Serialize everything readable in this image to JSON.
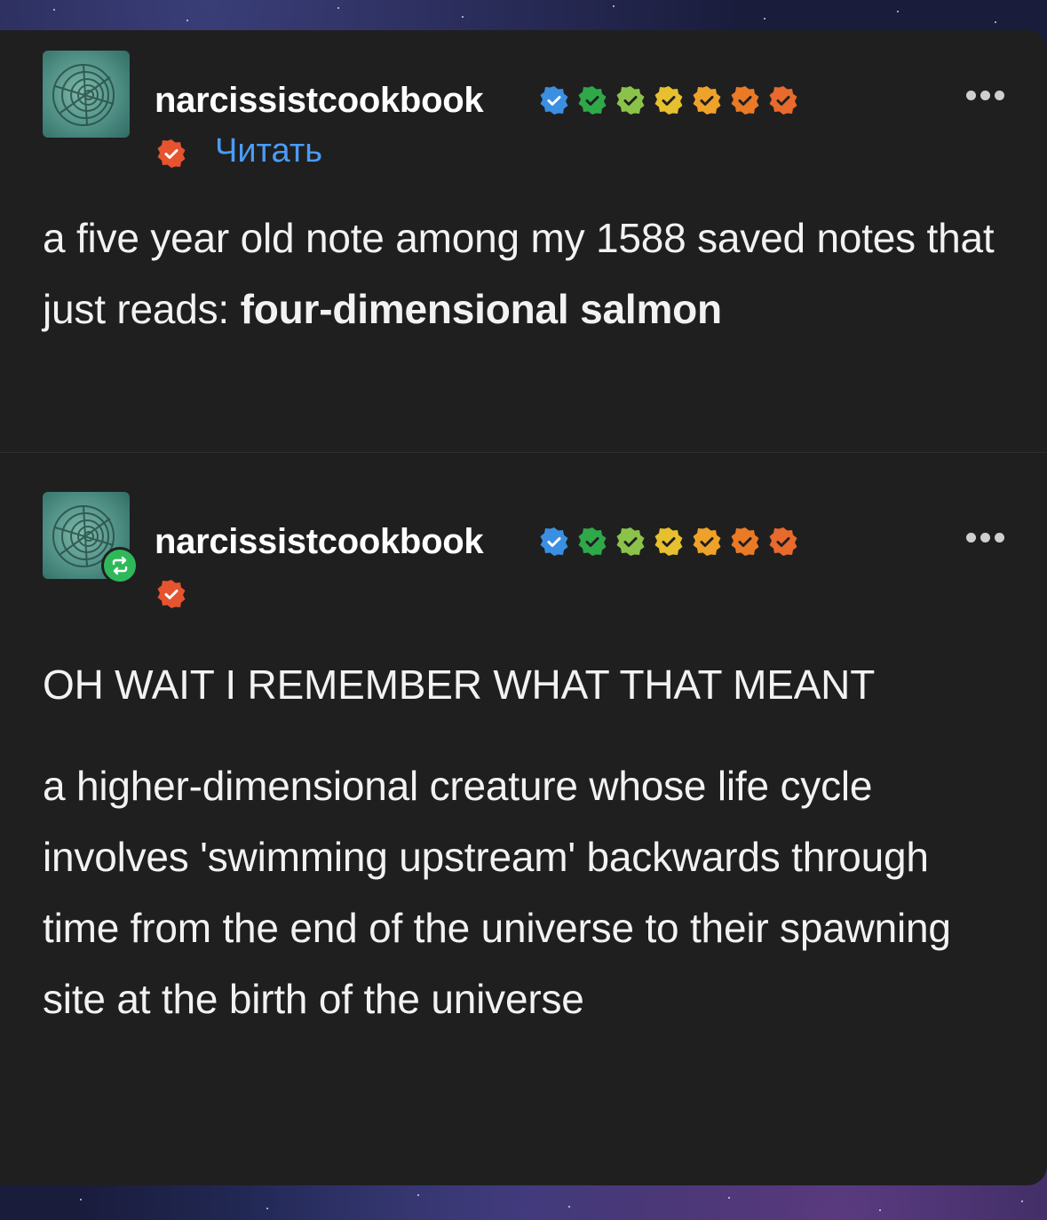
{
  "post1": {
    "username": "narcissistcookbook",
    "follow_label": "Читать",
    "text_prefix": "a five year old note among my 1588 saved notes that just reads: ",
    "text_bold": "four-dimensional salmon"
  },
  "post2": {
    "username": "narcissistcookbook",
    "paragraph1": "OH WAIT I REMEMBER WHAT THAT MEANT",
    "paragraph2": "a higher-dimensional creature whose life cycle involves 'swimming upstream' backwards through time from the end of the universe to their spawning site at the birth of the universe"
  },
  "badge_colors": [
    "#3b8fe0",
    "#2fa84a",
    "#8bc34a",
    "#e6c02e",
    "#eea22a",
    "#ea7a26",
    "#e5542e"
  ],
  "icons": {
    "avatar": "ammonite-shell-icon",
    "badge": "verified-check-badge-icon",
    "more": "more-dots-icon",
    "reblog": "reblog-icon"
  }
}
